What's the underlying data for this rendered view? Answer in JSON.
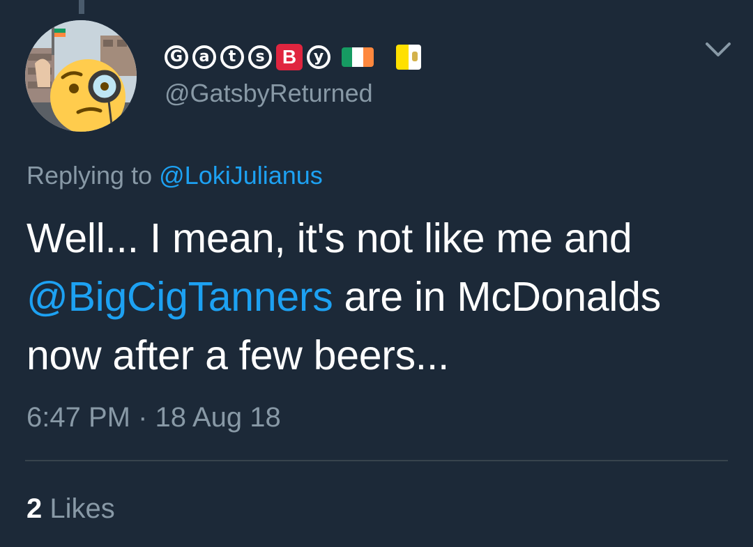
{
  "tweet": {
    "display_name_letters": [
      "G",
      "a",
      "t",
      "s",
      "B",
      "y"
    ],
    "handle": "@GatsbyReturned",
    "replying_to_label": "Replying to",
    "replying_to_handle": "@LokiJulianus",
    "text": {
      "part1": "Well... I mean, it's not like me and",
      "mention": "@BigCigTanners",
      "part2": "are in McDonalds now after a few beers..."
    },
    "time": "6:47 PM",
    "separator": "·",
    "date": "18 Aug 18",
    "likes_count": "2",
    "likes_label": "Likes"
  },
  "icons": {
    "avatar": "monocle-face-avatar",
    "flag_1": "ireland-flag-icon",
    "flag_2": "vatican-flag-icon",
    "menu": "chevron-down-icon"
  },
  "colors": {
    "background": "#1c2938",
    "text_primary": "#ffffff",
    "text_secondary": "#8899a6",
    "link": "#1da1f2",
    "divider": "#38444d",
    "b_badge": "#e0253f",
    "ireland_green": "#169b62",
    "ireland_orange": "#ff883e",
    "vatican_yellow": "#ffe000"
  }
}
